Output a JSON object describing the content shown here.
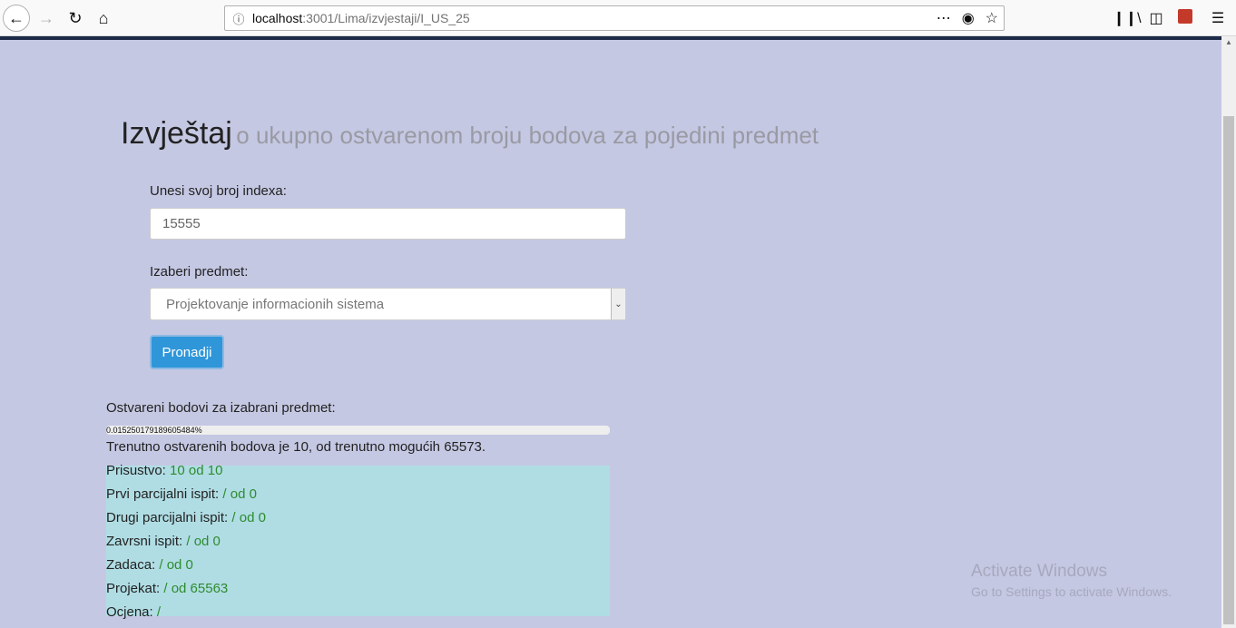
{
  "browser": {
    "url_host": "localhost",
    "url_rest": ":3001/Lima/izvjestaji/I_US_25"
  },
  "page": {
    "title": "Izvještaj",
    "subtitle": "o ukupno ostvarenom broju bodova za pojedini predmet",
    "index_label": "Unesi svoj broj indexa:",
    "index_value": "15555",
    "subject_label": "Izaberi predmet:",
    "subject_selected": "Projektovanje informacionih sistema",
    "find_button": "Pronadji",
    "points_label": "Ostvareni bodovi za izabrani predmet:",
    "progress_text": "0.015250179189605484%",
    "progress_percent": 0.015250179189605483,
    "summary": "Trenutno ostvarenih bodova je 10, od trenutno mogućih 65573.",
    "rows": [
      {
        "label": "Prisustvo:",
        "value": "10 od 10"
      },
      {
        "label": "Prvi parcijalni ispit:",
        "value": "/ od 0"
      },
      {
        "label": "Drugi parcijalni ispit:",
        "value": "/ od 0"
      },
      {
        "label": "Zavrsni ispit:",
        "value": "/ od 0"
      },
      {
        "label": "Zadaca:",
        "value": "/ od 0"
      },
      {
        "label": "Projekat:",
        "value": "/ od 65563"
      },
      {
        "label": "Ocjena:",
        "value": "/"
      }
    ]
  },
  "watermark": {
    "line1": "Activate Windows",
    "line2": "Go to Settings to activate Windows."
  },
  "colors": {
    "page_bg": "#c5c8e3",
    "results_bg": "#b0dde4",
    "value_green": "#2e8b2e",
    "button_blue": "#2f96d9"
  }
}
